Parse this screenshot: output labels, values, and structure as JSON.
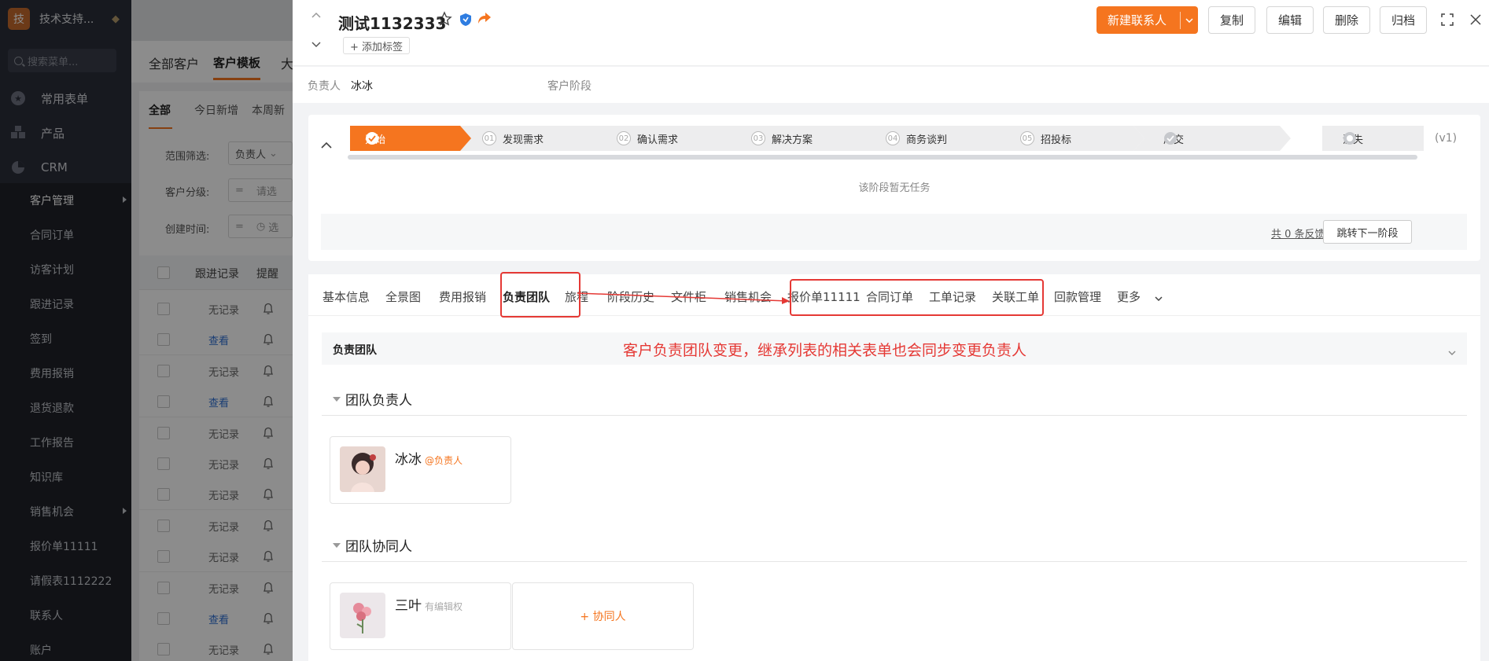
{
  "sidebar": {
    "logo_char": "技",
    "name": "技术支持...",
    "search_placeholder": "搜索菜单...",
    "top": [
      {
        "label": "常用表单",
        "icon": "star-icon"
      },
      {
        "label": "产品",
        "icon": "blocks-icon"
      },
      {
        "label": "CRM",
        "icon": "pie-icon"
      }
    ],
    "sub": [
      "客户管理",
      "合同订单",
      "访客计划",
      "跟进记录",
      "签到",
      "费用报销",
      "退货退款",
      "工作报告",
      "知识库",
      "销售机会",
      "报价单11111",
      "请假表1112222",
      "联系人",
      "账户"
    ]
  },
  "bg": {
    "tabs": [
      "全部客户",
      "客户模板",
      "大"
    ],
    "subtabs": [
      "全部",
      "今日新增",
      "本周新"
    ],
    "filters": {
      "scope_label": "范围筛选:",
      "scope_value": "负责人",
      "level_label": "客户分级:",
      "level_value": "请选",
      "created_label": "创建时间:",
      "created_value": "选"
    },
    "eq": "=",
    "headers": [
      "跟进记录",
      "提醒"
    ],
    "rows": [
      "无记录",
      "查看",
      "无记录",
      "查看",
      "无记录",
      "无记录",
      "无记录",
      "无记录",
      "无记录",
      "无记录",
      "查看",
      "无记录"
    ]
  },
  "header": {
    "title": "测试1132333",
    "add_tag": "+ 添加标签",
    "new_contact": "新建联系人",
    "buttons": [
      "复制",
      "编辑",
      "删除",
      "归档"
    ]
  },
  "owner": {
    "label": "负责人",
    "value": "冰冰",
    "stage_label": "客户阶段"
  },
  "stages": [
    {
      "num": "",
      "label": "开始"
    },
    {
      "num": "01",
      "label": "发现需求"
    },
    {
      "num": "02",
      "label": "确认需求"
    },
    {
      "num": "03",
      "label": "解决方案"
    },
    {
      "num": "04",
      "label": "商务谈判"
    },
    {
      "num": "05",
      "label": "招投标"
    },
    {
      "num": "",
      "label": "成交"
    },
    {
      "num": "",
      "label": "流失"
    }
  ],
  "version": "(v1)",
  "no_task": "该阶段暂无任务",
  "feedback": "共 0 条反馈",
  "jump_next": "跳转下一阶段",
  "tabs": [
    "基本信息",
    "全景图",
    "费用报销",
    "负责团队",
    "旅程",
    "阶段历史",
    "文件柜",
    "销售机会",
    "报价单11111",
    "合同订单",
    "工单记录",
    "关联工单",
    "回款管理",
    "更多"
  ],
  "section_title": "负责团队",
  "annotation": "客户负责团队变更，继承列表的相关表单也会同步变更负责人",
  "team_owner": {
    "title": "团队负责人",
    "name": "冰冰",
    "role": "@负责人"
  },
  "team_collab": {
    "title": "团队协同人",
    "name": "三叶",
    "role": "有编辑权",
    "add": "+ 协同人"
  },
  "colors": {
    "accent": "#f5751f",
    "highlight": "#e53935"
  }
}
